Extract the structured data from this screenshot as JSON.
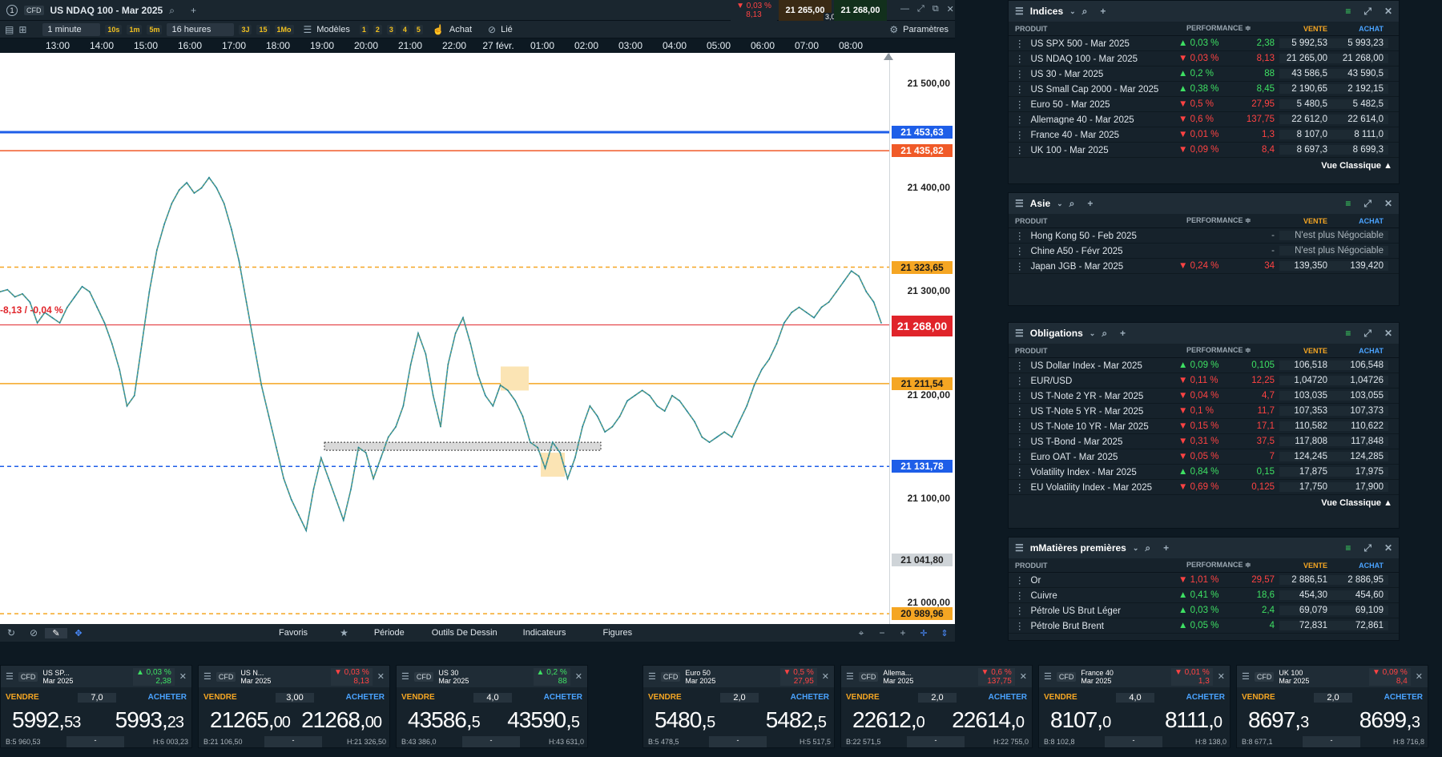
{
  "top": {
    "tab_num": "1",
    "cfd": "CFD",
    "instrument": "US NDAQ 100 - Mar 2025",
    "chg_pct": "▼ 0,03 %",
    "chg_pts": "8,13",
    "sell": "21 265,00",
    "buy": "21 268,00",
    "spread": "3,00"
  },
  "toolbar": {
    "interval": "1 minute",
    "q1": "10s",
    "q2": "1m",
    "q3": "5m",
    "range": "16 heures",
    "r1": "3J",
    "r2": "15",
    "r3": "1Mo",
    "models": "Modèles",
    "n1": "1",
    "n2": "2",
    "n3": "3",
    "n4": "4",
    "n5": "5",
    "buy": "Achat",
    "linked": "Lié",
    "settings": "Paramètres"
  },
  "timeaxis": [
    "13:00",
    "14:00",
    "15:00",
    "16:00",
    "17:00",
    "18:00",
    "19:00",
    "20:00",
    "21:00",
    "22:00",
    "27 févr.",
    "01:00",
    "02:00",
    "03:00",
    "04:00",
    "05:00",
    "06:00",
    "07:00",
    "08:00"
  ],
  "chart_data": {
    "type": "line",
    "instrument": "US NDAQ 100 - Mar 2025",
    "interval": "1 minute",
    "y_ticks": [
      "21 500,00",
      "21 400,00",
      "21 300,00",
      "21 200,00",
      "21 100,00",
      "21 000,00"
    ],
    "ylim": [
      20980,
      21530
    ],
    "levels": [
      {
        "label": "21 453,63",
        "value": 21453.63,
        "color": "#1e5ee8",
        "style": "solid"
      },
      {
        "label": "21 435,82",
        "value": 21435.82,
        "color": "#f05a28",
        "style": "solid"
      },
      {
        "label": "21 323,65",
        "value": 21323.65,
        "color": "#f5a623",
        "style": "dashed"
      },
      {
        "label": "21 211,54",
        "value": 21211.54,
        "color": "#f5a623",
        "style": "solid"
      },
      {
        "label": "21 131,78",
        "value": 21131.78,
        "color": "#1e5ee8",
        "style": "dashed"
      },
      {
        "label": "21 041,80",
        "value": 21041.8,
        "color": "#cfd4d8",
        "style": "solid"
      },
      {
        "label": "20 989,96",
        "value": 20989.96,
        "color": "#f5a623",
        "style": "dashed"
      }
    ],
    "current": {
      "label": "21 268,00",
      "value": 21268
    },
    "change_label": "-8,13 / -0,04 %",
    "series": [
      21300,
      21302,
      21295,
      21298,
      21290,
      21270,
      21280,
      21275,
      21270,
      21285,
      21295,
      21305,
      21300,
      21285,
      21270,
      21250,
      21225,
      21190,
      21200,
      21250,
      21300,
      21340,
      21365,
      21385,
      21398,
      21405,
      21395,
      21400,
      21410,
      21400,
      21385,
      21360,
      21330,
      21290,
      21250,
      21210,
      21180,
      21150,
      21120,
      21100,
      21085,
      21070,
      21110,
      21140,
      21120,
      21100,
      21080,
      21110,
      21150,
      21145,
      21120,
      21140,
      21160,
      21170,
      21190,
      21230,
      21260,
      21240,
      21200,
      21170,
      21230,
      21260,
      21275,
      21250,
      21220,
      21200,
      21190,
      21210,
      21205,
      21195,
      21180,
      21155,
      21150,
      21130,
      21155,
      21145,
      21120,
      21140,
      21170,
      21190,
      21180,
      21165,
      21170,
      21180,
      21195,
      21200,
      21205,
      21200,
      21190,
      21185,
      21200,
      21195,
      21185,
      21175,
      21160,
      21155,
      21160,
      21165,
      21160,
      21175,
      21190,
      21210,
      21225,
      21235,
      21250,
      21270,
      21280,
      21285,
      21280,
      21275,
      21285,
      21290,
      21300,
      21310,
      21320,
      21315,
      21300,
      21290,
      21270
    ]
  },
  "bottombar": {
    "fav": "Favoris",
    "period": "Période",
    "tools": "Outils De Dessin",
    "ind": "Indicateurs",
    "fig": "Figures"
  },
  "cols": {
    "prod": "PRODUIT",
    "perf": "PERFORMANCE ≑",
    "sell": "VENTE",
    "buy": "ACHAT"
  },
  "panels": {
    "indices": {
      "title": "Indices",
      "footer": "Vue Classique ▲",
      "rows": [
        [
          "US SPX 500 - Mar 2025",
          "▲ 0,03 %",
          "2,38",
          "5 992,53",
          "5 993,23",
          "up"
        ],
        [
          "US NDAQ 100 - Mar 2025",
          "▼ 0,03 %",
          "8,13",
          "21 265,00",
          "21 268,00",
          "dn"
        ],
        [
          "US 30 - Mar 2025",
          "▲ 0,2 %",
          "88",
          "43 586,5",
          "43 590,5",
          "up"
        ],
        [
          "US Small Cap 2000 - Mar 2025",
          "▲ 0,38 %",
          "8,45",
          "2 190,65",
          "2 192,15",
          "up"
        ],
        [
          "Euro 50 - Mar 2025",
          "▼ 0,5 %",
          "27,95",
          "5 480,5",
          "5 482,5",
          "dn"
        ],
        [
          "Allemagne 40 - Mar 2025",
          "▼ 0,6 %",
          "137,75",
          "22 612,0",
          "22 614,0",
          "dn"
        ],
        [
          "France 40 - Mar 2025",
          "▼ 0,01 %",
          "1,3",
          "8 107,0",
          "8 111,0",
          "dn"
        ],
        [
          "UK 100 - Mar 2025",
          "▼ 0,09 %",
          "8,4",
          "8 697,3",
          "8 699,3",
          "dn"
        ]
      ]
    },
    "asie": {
      "title": "Asie",
      "rows": [
        [
          "Hong Kong 50 - Feb 2025",
          "",
          "-",
          "N'est plus Négociable",
          "",
          "na"
        ],
        [
          "Chine A50 - Févr 2025",
          "",
          "-",
          "N'est plus Négociable",
          "",
          "na"
        ],
        [
          "Japan JGB - Mar 2025",
          "▼ 0,24 %",
          "34",
          "139,350",
          "139,420",
          "dn"
        ]
      ]
    },
    "oblig": {
      "title": "Obligations",
      "footer": "Vue Classique ▲",
      "rows": [
        [
          "US Dollar Index - Mar 2025",
          "▲ 0,09 %",
          "0,105",
          "106,518",
          "106,548",
          "up"
        ],
        [
          "EUR/USD",
          "▼ 0,11 %",
          "12,25",
          "1,04720",
          "1,04726",
          "dn"
        ],
        [
          "US T-Note 2 YR - Mar 2025",
          "▼ 0,04 %",
          "4,7",
          "103,035",
          "103,055",
          "dn"
        ],
        [
          "US T-Note 5 YR - Mar 2025",
          "▼ 0,1 %",
          "11,7",
          "107,353",
          "107,373",
          "dn"
        ],
        [
          "US T-Note 10 YR - Mar 2025",
          "▼ 0,15 %",
          "17,1",
          "110,582",
          "110,622",
          "dn"
        ],
        [
          "US T-Bond - Mar 2025",
          "▼ 0,31 %",
          "37,5",
          "117,808",
          "117,848",
          "dn"
        ],
        [
          "Euro OAT - Mar 2025",
          "▼ 0,05 %",
          "7",
          "124,245",
          "124,285",
          "dn"
        ],
        [
          "Volatility Index - Mar 2025",
          "▲ 0,84 %",
          "0,15",
          "17,875",
          "17,975",
          "up"
        ],
        [
          "EU Volatility Index - Mar 2025",
          "▼ 0,69 %",
          "0,125",
          "17,750",
          "17,900",
          "dn"
        ]
      ]
    },
    "mat": {
      "title": "mMatières premières",
      "rows": [
        [
          "Or",
          "▼ 1,01 %",
          "29,57",
          "2 886,51",
          "2 886,95",
          "dn"
        ],
        [
          "Cuivre",
          "▲ 0,41 %",
          "18,6",
          "454,30",
          "454,60",
          "up"
        ],
        [
          "Pétrole US Brut Léger",
          "▲ 0,03 %",
          "2,4",
          "69,079",
          "69,109",
          "up"
        ],
        [
          "Pétrole Brut Brent",
          "▲ 0,05 %",
          "4",
          "72,831",
          "72,861",
          "up"
        ]
      ]
    }
  },
  "tile_labels": {
    "sell": "VENDRE",
    "buy": "ACHETER",
    "cfd": "CFD",
    "dash": "-"
  },
  "tiles": [
    {
      "n1": "US SP...",
      "n2": "Mar 2025",
      "pct": "▲ 0,03 %",
      "pts": "2,38",
      "d": "up",
      "spread": "7,0",
      "s1": "5992,",
      "s2": "53",
      "b1": "5993,",
      "b2": "23",
      "lo": "B:5 960,53",
      "hi": "H:6 003,23"
    },
    {
      "n1": "US N...",
      "n2": "Mar 2025",
      "pct": "▼ 0,03 %",
      "pts": "8,13",
      "d": "dn",
      "spread": "3,00",
      "s1": "21265,",
      "s2": "00",
      "b1": "21268,",
      "b2": "00",
      "lo": "B:21 106,50",
      "hi": "H:21 326,50"
    },
    {
      "n1": "US 30",
      "n2": "Mar 2025",
      "pct": "▲ 0,2 %",
      "pts": "88",
      "d": "up",
      "spread": "4,0",
      "s1": "43586,",
      "s2": "5",
      "b1": "43590,",
      "b2": "5",
      "lo": "B:43 386,0",
      "hi": "H:43 631,0"
    },
    {
      "n1": "Euro 50",
      "n2": "Mar 2025",
      "pct": "▼ 0,5 %",
      "pts": "27,95",
      "d": "dn",
      "spread": "2,0",
      "s1": "5480,",
      "s2": "5",
      "b1": "5482,",
      "b2": "5",
      "lo": "B:5 478,5",
      "hi": "H:5 517,5"
    },
    {
      "n1": "Allema...",
      "n2": "Mar 2025",
      "pct": "▼ 0,6 %",
      "pts": "137,75",
      "d": "dn",
      "spread": "2,0",
      "s1": "22612,",
      "s2": "0",
      "b1": "22614,",
      "b2": "0",
      "lo": "B:22 571,5",
      "hi": "H:22 755,0"
    },
    {
      "n1": "France 40",
      "n2": "Mar 2025",
      "pct": "▼ 0,01 %",
      "pts": "1,3",
      "d": "dn",
      "spread": "4,0",
      "s1": "8107,",
      "s2": "0",
      "b1": "8111,",
      "b2": "0",
      "lo": "B:8 102,8",
      "hi": "H:8 138,0"
    },
    {
      "n1": "UK 100",
      "n2": "Mar 2025",
      "pct": "▼ 0,09 %",
      "pts": "8,4",
      "d": "dn",
      "spread": "2,0",
      "s1": "8697,",
      "s2": "3",
      "b1": "8699,",
      "b2": "3",
      "lo": "B:8 677,1",
      "hi": "H:8 716,8"
    }
  ]
}
